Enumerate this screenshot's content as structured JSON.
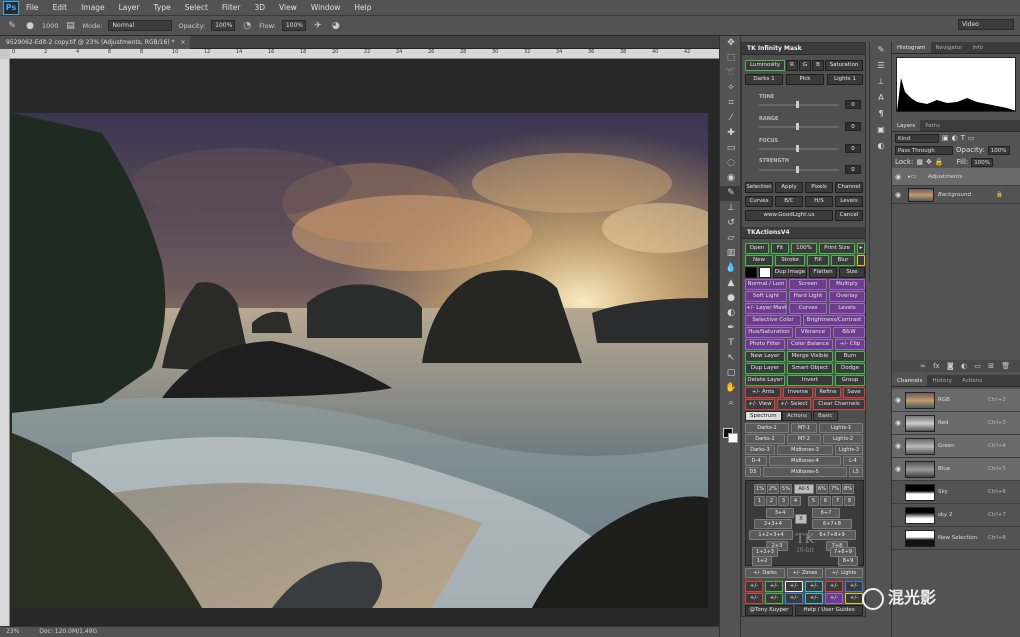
{
  "menu": [
    "File",
    "Edit",
    "Image",
    "Layer",
    "Type",
    "Select",
    "Filter",
    "3D",
    "View",
    "Window",
    "Help"
  ],
  "options": {
    "brush_size": "1000",
    "mode_label": "Mode:",
    "mode_value": "Normal",
    "opacity_label": "Opacity:",
    "opacity_value": "100%",
    "flow_label": "Flow:",
    "flow_value": "100%",
    "workspace": "Video"
  },
  "doc_tab": "9529062-Edit-2 copy.tif @ 23% (Adjustments, RGB/16) *",
  "status": {
    "zoom": "23%",
    "doc": "Doc: 120.0M/1.49G"
  },
  "ruler_marks": [
    "0",
    "2",
    "4",
    "6",
    "8",
    "10",
    "12",
    "14",
    "16",
    "18",
    "20",
    "22",
    "24",
    "26",
    "28",
    "30",
    "32",
    "34",
    "36",
    "38",
    "40",
    "42"
  ],
  "tk_mask": {
    "title": "TK Infinity Mask",
    "row1": [
      "Luminosity",
      "R",
      "G",
      "B",
      "Saturation"
    ],
    "row2": [
      "Darks 1",
      "Pick",
      "Lights 1"
    ],
    "sliders": [
      {
        "label": "TONE",
        "value": "0"
      },
      {
        "label": "RANGE",
        "value": "0"
      },
      {
        "label": "FOCUS",
        "value": "0"
      },
      {
        "label": "STRENGTH",
        "value": "0"
      }
    ],
    "row3": [
      "Selection",
      "Apply",
      "Pixels",
      "Channel"
    ],
    "row4": [
      "Curves",
      "B/C",
      "H/S",
      "Levels"
    ],
    "row5": [
      "www.GoodLight.us",
      "Cancel"
    ]
  },
  "tk_actions": {
    "title": "TKActionsV4",
    "r1": [
      "Open",
      "Fit",
      "100%",
      "Print Size"
    ],
    "r2": [
      "New",
      "Stroke",
      "Fill",
      "Blur"
    ],
    "r3": [
      "Dup Image",
      "Flatten",
      "Size"
    ],
    "r4": [
      "Normal / Lum",
      "Screen",
      "Multiply"
    ],
    "r5": [
      "Soft Light",
      "Hard Light",
      "Overlay"
    ],
    "r6": [
      "+/- Layer Mask",
      "Curves",
      "Levels"
    ],
    "r7": [
      "Selective Color",
      "Brightness/Contrast"
    ],
    "r8": [
      "Hue/Saturation",
      "Vibrance",
      "B&W"
    ],
    "r9": [
      "Photo Filter",
      "Color Balance",
      "+/- Clip"
    ],
    "r10": [
      "New Layer",
      "Merge Visible",
      "Burn"
    ],
    "r11": [
      "Dup Layer",
      "Smart Object",
      "Dodge"
    ],
    "r12": [
      "Delete Layer",
      "Invert",
      "Group"
    ],
    "r13": [
      "+/- Ants",
      "Inverse",
      "Refine",
      "Save"
    ],
    "r14": [
      "+/- View",
      "+/- Select",
      "Clear Channels"
    ]
  },
  "spectrum": {
    "tabs": [
      "Spectrum",
      "Actions",
      "Basic"
    ],
    "g1": [
      "Darks-1",
      "MT-1",
      "Lights-1"
    ],
    "g2": [
      "Darks-2",
      "MT-2",
      "Lights-2"
    ],
    "g3": [
      "Darks-3",
      "Midtones-3",
      "Lights-3"
    ],
    "g4": [
      "D-4",
      "Midtones-4",
      "L-4"
    ],
    "g5": [
      "D5",
      "Midtones-5",
      "L5"
    ],
    "pct": [
      "1%",
      "2%",
      "5%",
      "All-5",
      "6%",
      "7%",
      "8%"
    ],
    "nums": [
      "1",
      "2",
      "3",
      "4",
      "5",
      "6",
      "7",
      "8"
    ],
    "zone_a": [
      "3+4",
      "6+7",
      "2+3+4",
      "X",
      "6+7+8",
      "1+2+3+4",
      "6+7+8+9",
      "2+3",
      "7+8",
      "1+2+3",
      "7+8+9",
      "1+2",
      "8+9"
    ],
    "mark": "TK",
    "bit": "16-bit",
    "bottom": [
      "+/- Darks",
      "+/- Zones",
      "+/- Lights"
    ],
    "plus": "+/-",
    "credit": [
      "@Tony Kuyper",
      "Help / User Guides"
    ]
  },
  "right_tabs": {
    "top": [
      "Histogram",
      "Navigator",
      "Info"
    ],
    "layers_tabs": [
      "Layers",
      "Paths"
    ],
    "channels_tabs": [
      "Channels",
      "History",
      "Actions"
    ]
  },
  "layers": {
    "kind": "Kind",
    "blend": "Pass Through",
    "opacity_label": "Opacity:",
    "opacity": "100%",
    "lock_label": "Lock:",
    "fill_label": "Fill:",
    "fill": "100%",
    "items": [
      "Adjustments",
      "Background"
    ]
  },
  "channels": [
    {
      "name": "RGB",
      "key": "Ctrl+2"
    },
    {
      "name": "Red",
      "key": "Ctrl+3"
    },
    {
      "name": "Green",
      "key": "Ctrl+4"
    },
    {
      "name": "Blue",
      "key": "Ctrl+5"
    },
    {
      "name": "Sky",
      "key": "Ctrl+6"
    },
    {
      "name": "sky 2",
      "key": "Ctrl+7"
    },
    {
      "name": "New Selection",
      "key": "Ctrl+8"
    }
  ],
  "brand": "混光影",
  "colors": {
    "accent": "#31a8ff",
    "panel": "#535353",
    "dark": "#282828"
  }
}
